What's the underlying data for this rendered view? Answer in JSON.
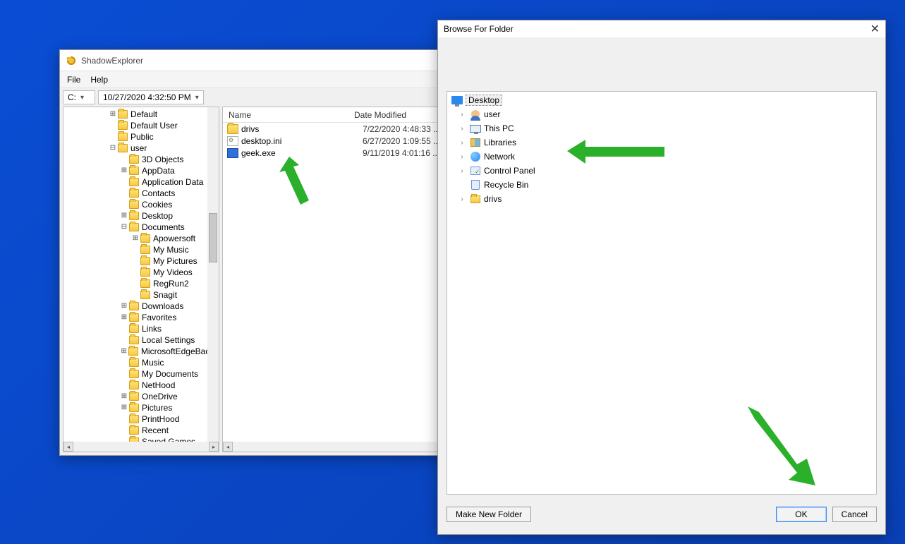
{
  "shadow_explorer": {
    "title": "ShadowExplorer",
    "menu": {
      "file": "File",
      "help": "Help"
    },
    "drive": "C:",
    "snapshot": "10/27/2020 4:32:50 PM",
    "tree": [
      {
        "d": 2,
        "exp": "+",
        "label": "Default"
      },
      {
        "d": 2,
        "exp": "",
        "label": "Default User"
      },
      {
        "d": 2,
        "exp": "",
        "label": "Public"
      },
      {
        "d": 2,
        "exp": "-",
        "label": "user"
      },
      {
        "d": 3,
        "exp": "",
        "label": "3D Objects"
      },
      {
        "d": 3,
        "exp": "+",
        "label": "AppData"
      },
      {
        "d": 3,
        "exp": "",
        "label": "Application Data"
      },
      {
        "d": 3,
        "exp": "",
        "label": "Contacts"
      },
      {
        "d": 3,
        "exp": "",
        "label": "Cookies"
      },
      {
        "d": 3,
        "exp": "+",
        "label": "Desktop"
      },
      {
        "d": 3,
        "exp": "-",
        "label": "Documents"
      },
      {
        "d": 4,
        "exp": "+",
        "label": "Apowersoft"
      },
      {
        "d": 4,
        "exp": "",
        "label": "My Music"
      },
      {
        "d": 4,
        "exp": "",
        "label": "My Pictures"
      },
      {
        "d": 4,
        "exp": "",
        "label": "My Videos"
      },
      {
        "d": 4,
        "exp": "",
        "label": "RegRun2"
      },
      {
        "d": 4,
        "exp": "",
        "label": "Snagit"
      },
      {
        "d": 3,
        "exp": "+",
        "label": "Downloads"
      },
      {
        "d": 3,
        "exp": "+",
        "label": "Favorites"
      },
      {
        "d": 3,
        "exp": "",
        "label": "Links"
      },
      {
        "d": 3,
        "exp": "",
        "label": "Local Settings"
      },
      {
        "d": 3,
        "exp": "+",
        "label": "MicrosoftEdgeBacku"
      },
      {
        "d": 3,
        "exp": "",
        "label": "Music"
      },
      {
        "d": 3,
        "exp": "",
        "label": "My Documents"
      },
      {
        "d": 3,
        "exp": "",
        "label": "NetHood"
      },
      {
        "d": 3,
        "exp": "+",
        "label": "OneDrive"
      },
      {
        "d": 3,
        "exp": "+",
        "label": "Pictures"
      },
      {
        "d": 3,
        "exp": "",
        "label": "PrintHood"
      },
      {
        "d": 3,
        "exp": "",
        "label": "Recent"
      },
      {
        "d": 3,
        "exp": "",
        "label": "Saved Games"
      }
    ],
    "list_cols": {
      "name": "Name",
      "date": "Date Modified"
    },
    "list_rows": [
      {
        "icon": "folder",
        "name": "drivs",
        "date": "7/22/2020 4:48:33 ..."
      },
      {
        "icon": "ini",
        "name": "desktop.ini",
        "date": "6/27/2020 1:09:55 ..."
      },
      {
        "icon": "exe",
        "name": "geek.exe",
        "date": "9/11/2019 4:01:16 ..."
      }
    ]
  },
  "browse_dialog": {
    "title": "Browse For Folder",
    "items": [
      {
        "icon": "desktop",
        "label": "Desktop",
        "sel": true,
        "chv": ""
      },
      {
        "icon": "user",
        "label": "user",
        "chv": ">"
      },
      {
        "icon": "pc",
        "label": "This PC",
        "chv": ">"
      },
      {
        "icon": "lib",
        "label": "Libraries",
        "chv": ">"
      },
      {
        "icon": "net",
        "label": "Network",
        "chv": ">"
      },
      {
        "icon": "cpl",
        "label": "Control Panel",
        "chv": ">"
      },
      {
        "icon": "bin",
        "label": "Recycle Bin",
        "chv": ""
      },
      {
        "icon": "drivs",
        "label": "drivs",
        "chv": ">"
      }
    ],
    "buttons": {
      "new_folder": "Make New Folder",
      "ok": "OK",
      "cancel": "Cancel"
    }
  }
}
